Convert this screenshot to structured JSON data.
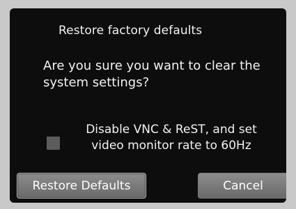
{
  "dialog": {
    "title": "Restore factory defaults",
    "message": "Are you sure you want to clear the system settings?",
    "option": {
      "label_line1": "Disable VNC & ReST, and set",
      "label_line2": "video monitor rate to 60Hz",
      "checked": false
    },
    "buttons": {
      "restore_label": "Restore Defaults",
      "cancel_label": "Cancel"
    }
  }
}
